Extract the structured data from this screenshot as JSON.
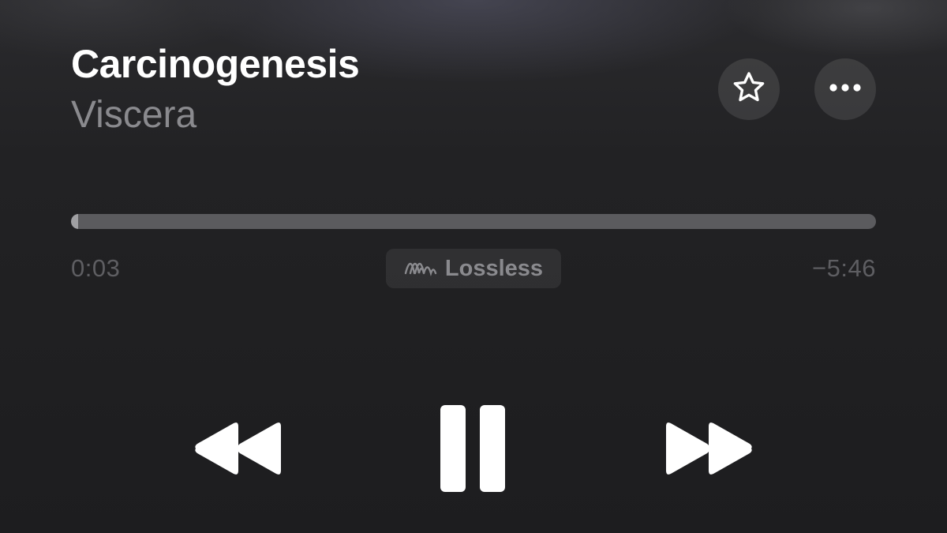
{
  "track": {
    "title": "Carcinogenesis",
    "artist": "Viscera"
  },
  "playback": {
    "elapsed": "0:03",
    "remaining": "−5:46",
    "progress_fraction": 0.009,
    "state": "playing"
  },
  "badge": {
    "label": "Lossless",
    "icon": "lossless-wave-icon"
  },
  "actions": {
    "favorite_icon": "star-icon",
    "more_icon": "ellipsis-icon"
  },
  "controls": {
    "previous_icon": "rewind-icon",
    "pause_icon": "pause-icon",
    "next_icon": "fast-forward-icon"
  },
  "colors": {
    "background": "#1e1e20",
    "title": "#ffffff",
    "artist": "#8a8a8e",
    "progress_track": "#5b5b5e",
    "progress_fill": "#a0a0a3"
  }
}
